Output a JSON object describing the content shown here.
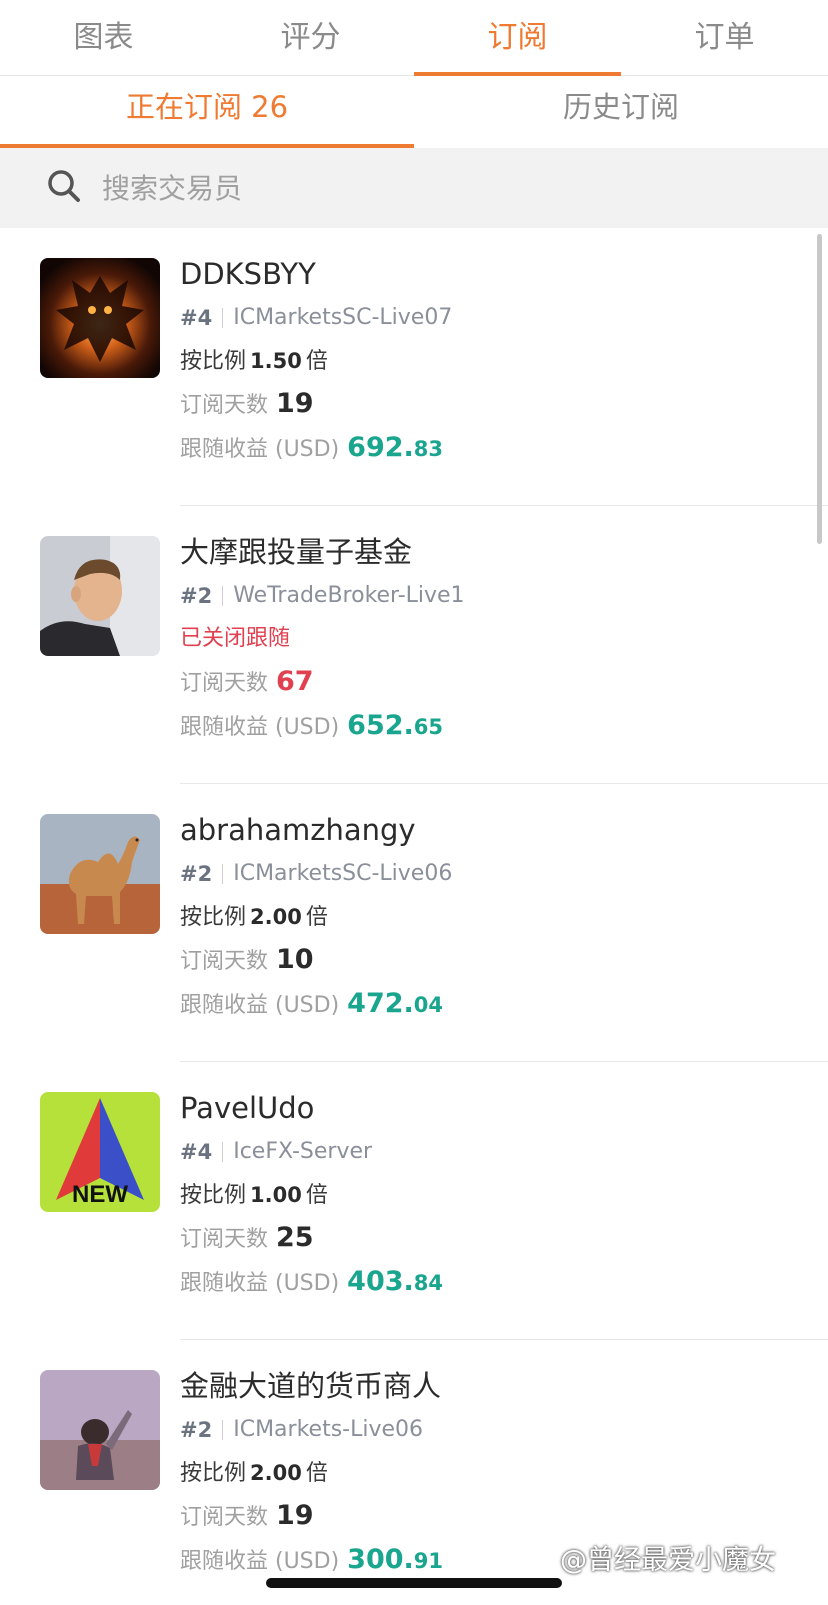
{
  "top_tabs": [
    {
      "label": "图表"
    },
    {
      "label": "评分"
    },
    {
      "label": "订阅"
    },
    {
      "label": "订单"
    }
  ],
  "sub_tabs": [
    {
      "label": "正在订阅 26"
    },
    {
      "label": "历史订阅"
    }
  ],
  "search": {
    "placeholder": "搜索交易员"
  },
  "traders": [
    {
      "name": "DDKSBYY",
      "rank": "#4",
      "server": "ICMarketsSC-Live07",
      "ratio_prefix": "按比例",
      "ratio": "1.50",
      "ratio_suffix": "倍",
      "days_label": "订阅天数",
      "days": "19",
      "profit_label": "跟随收益 (USD)",
      "profit_int": "692.",
      "profit_dec": "83",
      "avatar": "dark-demon-icon"
    },
    {
      "name": "大摩跟投量子基金",
      "rank": "#2",
      "server": "WeTradeBroker-Live1",
      "status": "已关闭跟随",
      "days_label": "订阅天数",
      "days": "67",
      "profit_label": "跟随收益 (USD)",
      "profit_int": "652.",
      "profit_dec": "65",
      "avatar": "man-portrait-icon"
    },
    {
      "name": "abrahamzhangy",
      "rank": "#2",
      "server": "ICMarketsSC-Live06",
      "ratio_prefix": "按比例",
      "ratio": "2.00",
      "ratio_suffix": "倍",
      "days_label": "订阅天数",
      "days": "10",
      "profit_label": "跟随收益 (USD)",
      "profit_int": "472.",
      "profit_dec": "04",
      "avatar": "camel-icon"
    },
    {
      "name": "PavelUdo",
      "rank": "#4",
      "server": "IceFX-Server",
      "ratio_prefix": "按比例",
      "ratio": "1.00",
      "ratio_suffix": "倍",
      "days_label": "订阅天数",
      "days": "25",
      "profit_label": "跟随收益 (USD)",
      "profit_int": "403.",
      "profit_dec": "84",
      "avatar": "new-arrow-icon",
      "avatar_text": "NEW"
    },
    {
      "name": "金融大道的货币商人",
      "rank": "#2",
      "server": "ICMarkets-Live06",
      "ratio_prefix": "按比例",
      "ratio": "2.00",
      "ratio_suffix": "倍",
      "days_label": "订阅天数",
      "days": "19",
      "profit_label": "跟随收益 (USD)",
      "profit_int": "300.",
      "profit_dec": "91",
      "avatar": "child-photo-icon"
    }
  ],
  "watermark": "@曾经最爱小魔女",
  "colors": {
    "accent": "#ef7a32",
    "profit": "#1aa58e",
    "alert": "#e0404f"
  }
}
